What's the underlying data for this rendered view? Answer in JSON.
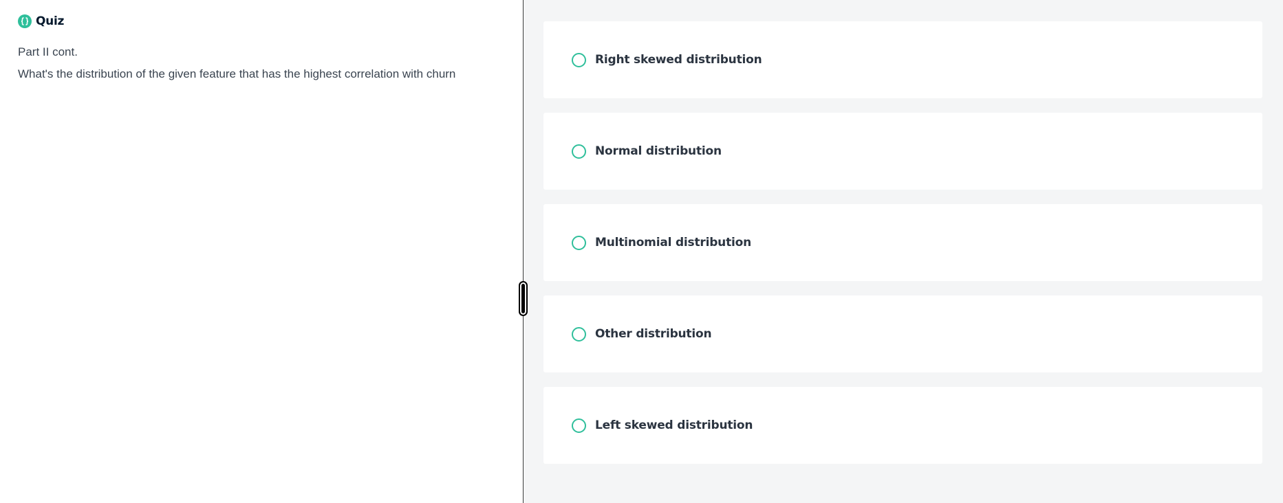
{
  "quiz": {
    "title": "Quiz",
    "part": "Part II cont.",
    "question": "What's the distribution of the given feature that has the highest correlation with churn",
    "icon": "braces-icon",
    "accent_color": "#2fbf9b"
  },
  "options": [
    {
      "label": "Right skewed distribution"
    },
    {
      "label": "Normal distribution"
    },
    {
      "label": "Multinomial distribution"
    },
    {
      "label": "Other distribution"
    },
    {
      "label": "Left skewed distribution"
    }
  ]
}
